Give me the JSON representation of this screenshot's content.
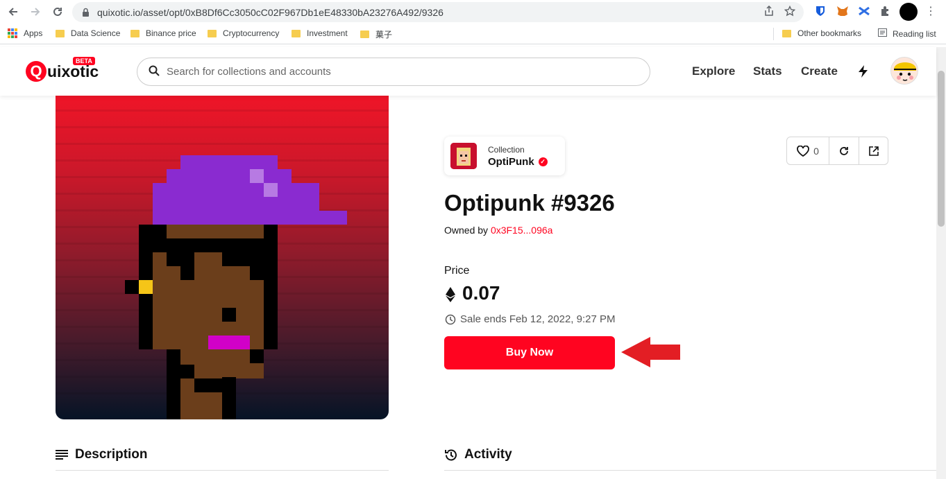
{
  "browser": {
    "url": "quixotic.io/asset/opt/0xB8Df6Cc3050cC02F967Db1eE48330bA23276A492/9326",
    "bookmarks": [
      {
        "label": "Apps",
        "icon": "apps-grid-icon"
      },
      {
        "label": "Data Science",
        "icon": "folder-icon"
      },
      {
        "label": "Binance price",
        "icon": "folder-icon"
      },
      {
        "label": "Cryptocurrency",
        "icon": "folder-icon"
      },
      {
        "label": "Investment",
        "icon": "folder-icon"
      },
      {
        "label": "菓子",
        "icon": "folder-icon"
      }
    ],
    "other_bookmarks": "Other bookmarks",
    "reading_list": "Reading list"
  },
  "site": {
    "logo_text": "uixotic",
    "logo_letter": "Q",
    "beta_badge": "BETA",
    "search_placeholder": "Search for collections and accounts",
    "nav": [
      "Explore",
      "Stats",
      "Create"
    ],
    "nav_icon": "lightning-icon"
  },
  "asset": {
    "collection_label": "Collection",
    "collection_name": "OptiPunk",
    "title": "Optipunk #9326",
    "owned_by_label": "Owned by",
    "owner": "0x3F15...096a",
    "favorites_count": "0",
    "price_label": "Price",
    "price": "0.07",
    "sale_ends": "Sale ends Feb 12, 2022, 9:27 PM",
    "buy_label": "Buy Now"
  },
  "sections": {
    "description": "Description",
    "activity": "Activity"
  },
  "colors": {
    "brand": "#ff0420",
    "hat": "#8a2bd0",
    "skin": "#6b3e1b",
    "lips": "#d100c8",
    "earring": "#f5c518",
    "arrow": "#e31e24"
  }
}
